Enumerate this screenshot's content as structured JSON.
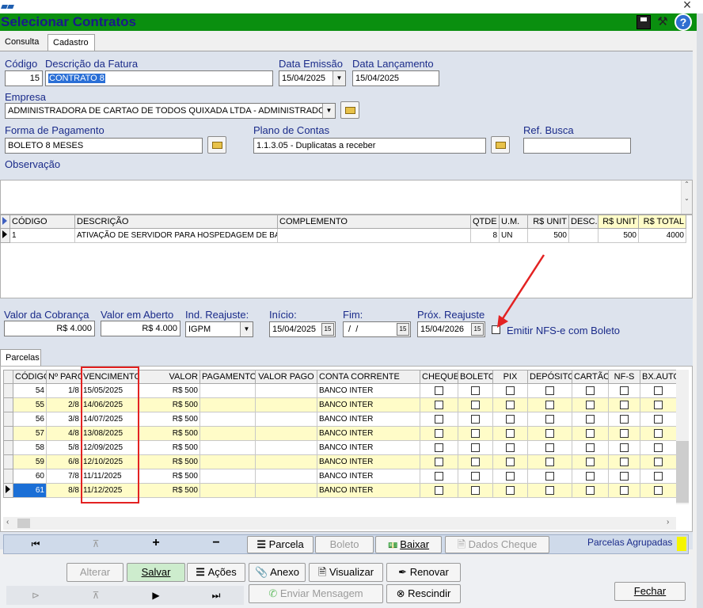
{
  "window": {
    "title": "Selecionar Contratos",
    "close_glyph": "×"
  },
  "tabs": {
    "consulta": "Consulta",
    "cadastro": "Cadastro"
  },
  "form": {
    "codigo_label": "Código",
    "codigo_value": "15",
    "descricao_label": "Descrição da Fatura",
    "descricao_value": "CONTRATO 8",
    "data_emissao_label": "Data Emissão",
    "data_emissao_value": "15/04/2025",
    "data_lancamento_label": "Data Lançamento",
    "data_lancamento_value": "15/04/2025",
    "empresa_label": "Empresa",
    "empresa_value": "ADMINISTRADORA DE CARTAO DE TODOS QUIXADA LTDA - ADMINISTRADORA D",
    "forma_pagamento_label": "Forma de Pagamento",
    "forma_pagamento_value": "BOLETO 8 MESES",
    "plano_contas_label": "Plano de Contas",
    "plano_contas_value": "1.1.3.05 - Duplicatas a receber",
    "ref_busca_label": "Ref. Busca",
    "ref_busca_value": "",
    "observacao_label": "Observação"
  },
  "items_grid": {
    "headers": [
      "CÓDIGO",
      "DESCRIÇÃO",
      "COMPLEMENTO",
      "QTDE",
      "U.M.",
      "R$ UNIT",
      "DESC.",
      "R$ UNIT",
      "R$ TOTAL"
    ],
    "rows": [
      [
        "1",
        "ATIVAÇÃO DE SERVIDOR PARA HOSPEDAGEM DE BANC",
        "",
        "8",
        "UN",
        "500",
        "",
        "500",
        "4000"
      ]
    ]
  },
  "billing": {
    "valor_cobranca_label": "Valor da Cobrança",
    "valor_cobranca_value": "R$ 4.000",
    "valor_aberto_label": "Valor em Aberto",
    "valor_aberto_value": "R$ 4.000",
    "ind_reajuste_label": "Ind. Reajuste:",
    "ind_reajuste_value": "IGPM",
    "inicio_label": "Início:",
    "inicio_value": "15/04/2025",
    "fim_label": "Fim:",
    "fim_value": " /  /",
    "prox_reajuste_label": "Próx. Reajuste",
    "prox_reajuste_value": "15/04/2026",
    "emitir_nfse_label": "Emitir NFS-e com Boleto"
  },
  "parcelas_tab": "Parcelas",
  "parcelas_grid": {
    "headers": [
      "CÓDIGO",
      "Nº PARC",
      "VENCIMENTO",
      "VALOR",
      "PAGAMENTO",
      "VALOR PAGO",
      "CONTA CORRENTE",
      "CHEQUE",
      "BOLETO",
      "PIX",
      "DEPÓSITO",
      "CARTÃO",
      "NF-S",
      "BX.AUTO"
    ],
    "rows": [
      [
        "54",
        "1/8",
        "15/05/2025",
        "R$ 500",
        "",
        "",
        "BANCO INTER"
      ],
      [
        "55",
        "2/8",
        "14/06/2025",
        "R$ 500",
        "",
        "",
        "BANCO INTER"
      ],
      [
        "56",
        "3/8",
        "14/07/2025",
        "R$ 500",
        "",
        "",
        "BANCO INTER"
      ],
      [
        "57",
        "4/8",
        "13/08/2025",
        "R$ 500",
        "",
        "",
        "BANCO INTER"
      ],
      [
        "58",
        "5/8",
        "12/09/2025",
        "R$ 500",
        "",
        "",
        "BANCO INTER"
      ],
      [
        "59",
        "6/8",
        "12/10/2025",
        "R$ 500",
        "",
        "",
        "BANCO INTER"
      ],
      [
        "60",
        "7/8",
        "11/11/2025",
        "R$ 500",
        "",
        "",
        "BANCO INTER"
      ],
      [
        "61",
        "8/8",
        "11/12/2025",
        "R$ 500",
        "",
        "",
        "BANCO INTER"
      ]
    ]
  },
  "parcelas_nav": {
    "first": "⏮",
    "prior": "⊼",
    "add": "+",
    "remove": "−",
    "parcela": "Parcela",
    "boleto": "Boleto",
    "baixar": "Baixar",
    "dados_cheque": "Dados Cheque",
    "parcelas_agrupadas": "Parcelas Agrupadas"
  },
  "actions": {
    "alterar": "Alterar",
    "salvar": "Salvar",
    "acoes": "Ações",
    "anexo": "Anexo",
    "visualizar": "Visualizar",
    "renovar": "Renovar",
    "enviar_mensagem": "Enviar Mensagem",
    "rescindir": "Rescindir",
    "fechar": "Fechar"
  },
  "bottom_nav": {
    "first": "⊳",
    "prior": "⊼",
    "next": "▶",
    "last": "⏭"
  },
  "colors": {
    "title_bar": "#0a8f0f",
    "title_text": "#1a1a8a",
    "label": "#1a2b8a",
    "highlight_row": "#fffcc8",
    "annotation": "#e32222"
  }
}
